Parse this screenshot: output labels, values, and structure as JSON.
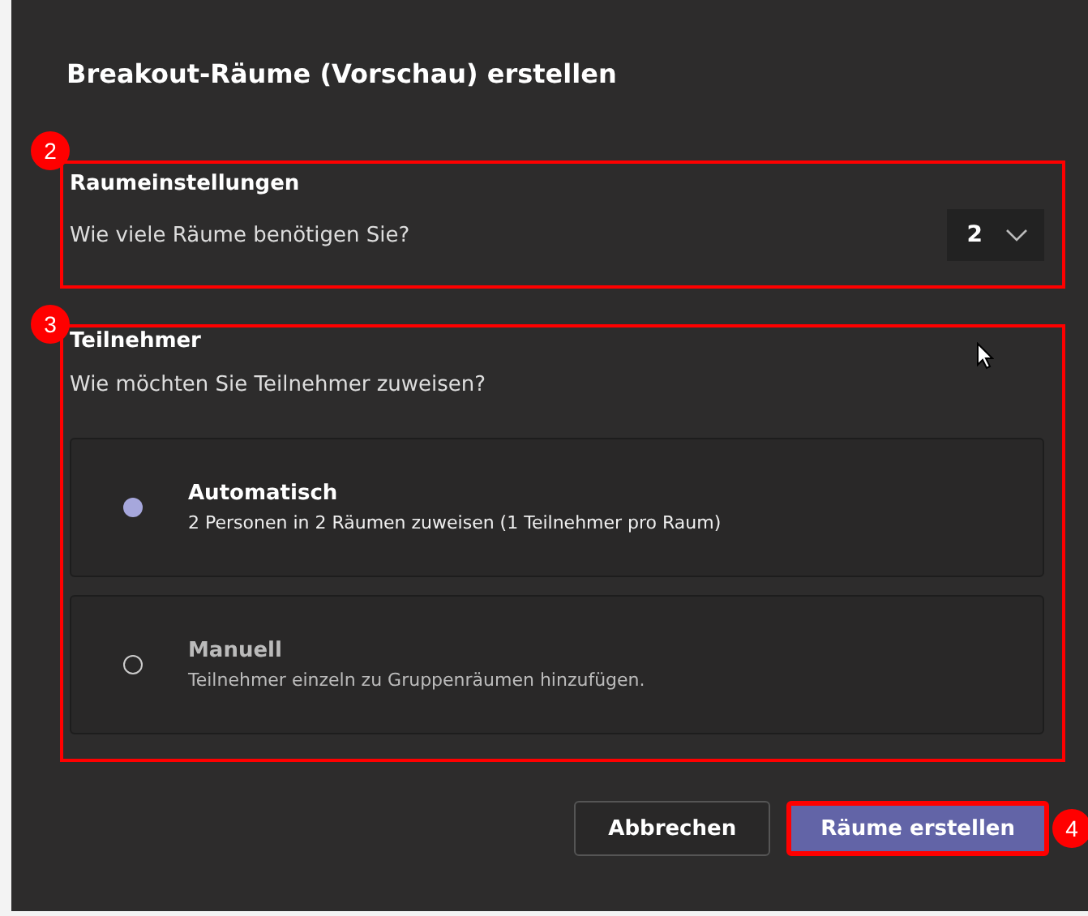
{
  "dialog": {
    "title": "Breakout-Räume (Vorschau) erstellen"
  },
  "room_settings": {
    "marker": "2",
    "heading": "Raumeinstellungen",
    "question": "Wie viele Räume benötigen Sie?",
    "room_count": "2"
  },
  "participants": {
    "marker": "3",
    "heading": "Teilnehmer",
    "question": "Wie möchten Sie Teilnehmer zuweisen?",
    "options": [
      {
        "label": "Automatisch",
        "description": "2 Personen in 2 Räumen zuweisen (1 Teilnehmer pro Raum)",
        "selected": true
      },
      {
        "label": "Manuell",
        "description": "Teilnehmer einzeln zu Gruppenräumen hinzufügen.",
        "selected": false
      }
    ]
  },
  "buttons": [
    {
      "label": "Abbrechen",
      "kind": "secondary"
    },
    {
      "label": "Räume erstellen",
      "kind": "primary",
      "marker": "4"
    }
  ]
}
